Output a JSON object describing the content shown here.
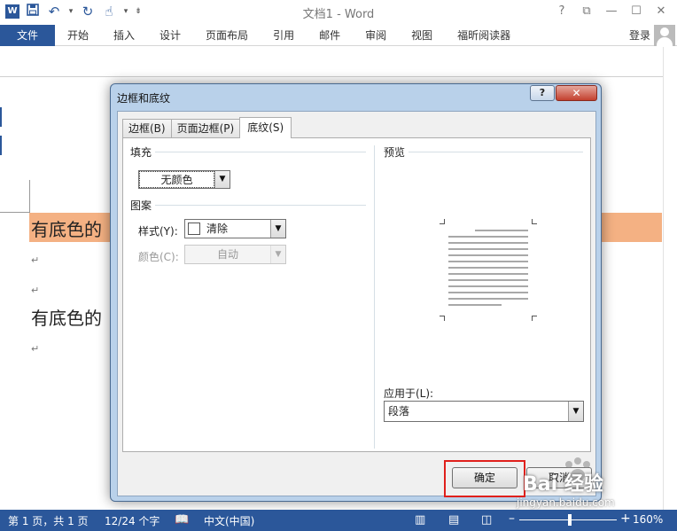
{
  "window": {
    "title": "文档1 - Word",
    "buttons": [
      "?",
      "⧉",
      "—",
      "☐",
      "✕"
    ]
  },
  "ribbon": {
    "file_tab": "文件",
    "tabs": [
      "开始",
      "插入",
      "设计",
      "页面布局",
      "引用",
      "邮件",
      "审阅",
      "视图",
      "福昕阅读器"
    ],
    "login": "登录"
  },
  "document": {
    "paragraph_1": "有底色的",
    "paragraph_2": "有底色的",
    "para_mark": "↵",
    "highlight_color": "#f4b183"
  },
  "dialog": {
    "title": "边框和底纹",
    "help": "?",
    "close": "✕",
    "tabs": [
      "边框(B)",
      "页面边框(P)",
      "底纹(S)"
    ],
    "active_tab": "底纹(S)",
    "fill_label": "填充",
    "fill_value": "无颜色",
    "pattern_label": "图案",
    "style_label": "样式(Y):",
    "style_value": "清除",
    "color_label": "颜色(C):",
    "color_value": "自动",
    "preview_label": "预览",
    "apply_label": "应用于(L):",
    "apply_value": "段落",
    "ok": "确定",
    "cancel": "取消"
  },
  "statusbar": {
    "page": "第 1 页，共 1 页",
    "words": "12/24 个字",
    "language": "中文(中国)",
    "zoom_minus": "–",
    "zoom_plus": "+",
    "zoom": "160%"
  },
  "watermark": {
    "text": "jingyan.baidu.com",
    "brand": "Bai 经验"
  }
}
